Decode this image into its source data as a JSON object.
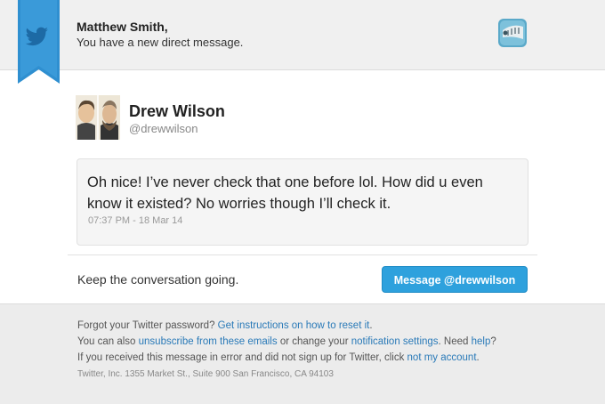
{
  "header": {
    "recipient": "Matthew Smith,",
    "subtitle": "You have a new direct message.",
    "ribbon_icon": "twitter-bird-icon",
    "app_icon": "twitter-app-icon",
    "ribbon_color": "#2f8fd0"
  },
  "sender": {
    "name": "Drew Wilson",
    "handle": "@drewwilson",
    "avatar": "avatar-illustration"
  },
  "message": {
    "text": "Oh nice! I’ve never check that one before lol. How did u even know it existed? No worries though I’ll check it.",
    "timestamp": "07:37 PM - 18 Mar 14"
  },
  "cta": {
    "prompt": "Keep the conversation going.",
    "button_label": "Message @drewwilson",
    "button_color": "#2ea1dd"
  },
  "footer": {
    "line1_prefix": "Forgot your Twitter password?",
    "line1_link": "Get instructions on how to reset it",
    "line1_suffix": ".",
    "line2_prefix": "You can also",
    "line2_link1": "unsubscribe from these emails",
    "line2_mid": "or change your",
    "line2_link2": "notification settings",
    "line2_mid2": ". Need",
    "line2_link3": "help",
    "line2_suffix": "?",
    "line3_prefix": "If you received this message in error and did not sign up for Twitter, click",
    "line3_link": "not my account",
    "line3_suffix": ".",
    "address": "Twitter, Inc. 1355 Market St., Suite 900 San Francisco, CA 94103",
    "link_color": "#2a7ab8"
  }
}
